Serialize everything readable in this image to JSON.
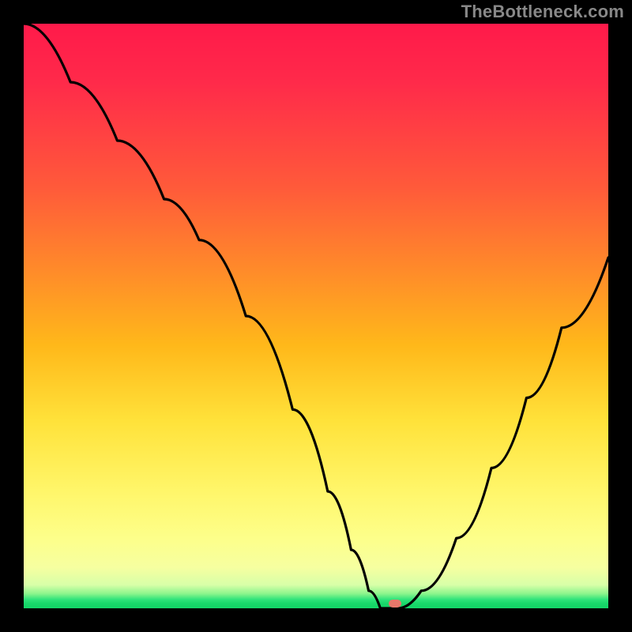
{
  "watermark": "TheBottleneck.com",
  "colors": {
    "frame_bg": "#000000",
    "curve": "#000000",
    "marker": "#e8776a",
    "gradient_stops": [
      "#ff1a4a",
      "#ff2a4a",
      "#ff5a3a",
      "#ff8a2a",
      "#ffb81a",
      "#ffe23a",
      "#fff66a",
      "#fdff8a",
      "#f6ffa0",
      "#d8ffa8",
      "#8cf58c",
      "#2fe37a",
      "#18d86a",
      "#14d467"
    ]
  },
  "chart_data": {
    "type": "line",
    "title": "",
    "xlabel": "",
    "ylabel": "",
    "xlim": [
      0,
      100
    ],
    "ylim": [
      0,
      100
    ],
    "grid": false,
    "legend": false,
    "annotations": [
      {
        "text": "TheBottleneck.com",
        "position": "top-right"
      }
    ],
    "series": [
      {
        "name": "bottleneck-curve",
        "x": [
          0,
          8,
          16,
          24,
          30,
          38,
          46,
          52,
          56,
          59,
          61,
          64,
          68,
          74,
          80,
          86,
          92,
          100
        ],
        "y": [
          100,
          90,
          80,
          70,
          63,
          50,
          34,
          20,
          10,
          3,
          0,
          0,
          3,
          12,
          24,
          36,
          48,
          60
        ]
      }
    ],
    "marker": {
      "x": 63.5,
      "y": 0.8
    }
  }
}
